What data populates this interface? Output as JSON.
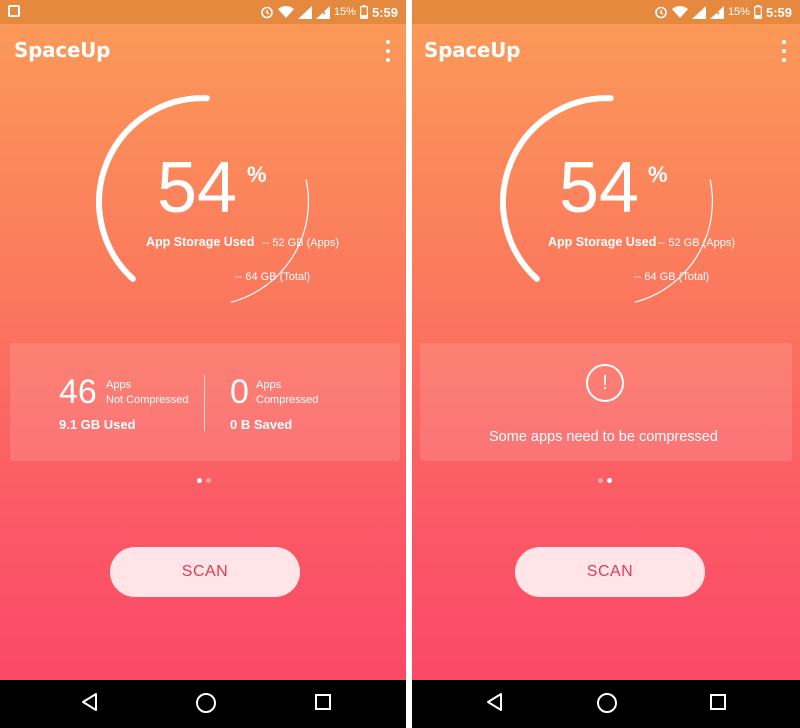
{
  "status": {
    "battery_percent": "15%",
    "time": "5:59"
  },
  "app": {
    "title": "SpaceUp"
  },
  "gauge": {
    "percent": "54",
    "percent_sign": "%",
    "label": "App Storage Used",
    "apps_size": "-- 52 GB (Apps)",
    "total_size": "-- 64 GB (Total)",
    "fill_fraction": 0.54
  },
  "card_stats": {
    "not_compressed_count": "46",
    "not_compressed_label_1": "Apps",
    "not_compressed_label_2": "Not Compressed",
    "used": "9.1 GB Used",
    "compressed_count": "0",
    "compressed_label_1": "Apps",
    "compressed_label_2": "Compressed",
    "saved": "0 B Saved"
  },
  "card_warning": {
    "icon": "!",
    "message": "Some apps need to be compressed"
  },
  "scan_label": "SCAN",
  "colors": {
    "gradient_top": "#fb9c58",
    "gradient_bottom": "#fb4468",
    "scan_text": "#e33a5a"
  },
  "icons": [
    "image-icon",
    "alarm-icon",
    "wifi-icon",
    "signal-icon",
    "battery-icon",
    "more-vert-icon",
    "back-icon",
    "home-icon",
    "recents-icon",
    "exclamation-icon"
  ]
}
